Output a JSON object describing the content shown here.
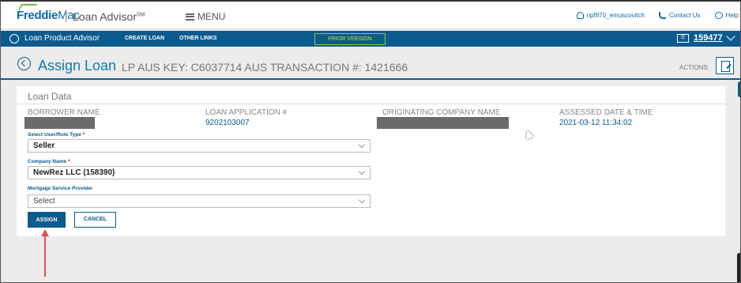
{
  "header": {
    "brand": "Freddie",
    "brand_suffix": "Mac",
    "product": "Loan Advisor",
    "product_mark": "SM",
    "menu_label": "MENU",
    "user": "npf870_emuscovitch",
    "contact": "Contact Us",
    "help": "Help"
  },
  "nav": {
    "title": "Loan Product Advisor",
    "create_loan": "CREATE LOAN",
    "other_links": "OTHER LINKS",
    "prior_version": "PRIOR VERSION",
    "badge": "☰",
    "seller_number": "159477"
  },
  "page": {
    "title": "Assign Loan",
    "subtitle": "LP AUS KEY: C6037714 AUS TRANSACTION #: 1421666",
    "actions_label": "ACTIONS:"
  },
  "loan_data": {
    "section_title": "Loan Data",
    "columns": [
      {
        "label": "BORROWER NAME",
        "value": ""
      },
      {
        "label": "LOAN APPLICATION #",
        "value": "9202103007"
      },
      {
        "label": "ORIGINATING COMPANY NAME",
        "value": ""
      },
      {
        "label": "ASSESSED DATE & TIME",
        "value": "2021-03-12 11:34:02"
      }
    ]
  },
  "form": {
    "role_label": "Select User/Role Type",
    "role_value": "Seller",
    "company_label": "Company Name",
    "company_value": "NewRez LLC (158390)",
    "msp_label": "Mortgage Service Provider",
    "msp_value": "Select",
    "required_mark": "*",
    "assign_label": "ASSIGN",
    "cancel_label": "CANCEL"
  },
  "colors": {
    "brand_blue": "#0d5b8e",
    "accent_green": "#8fc53f",
    "required_red": "#d0021b",
    "annotation_red": "#e35050"
  }
}
